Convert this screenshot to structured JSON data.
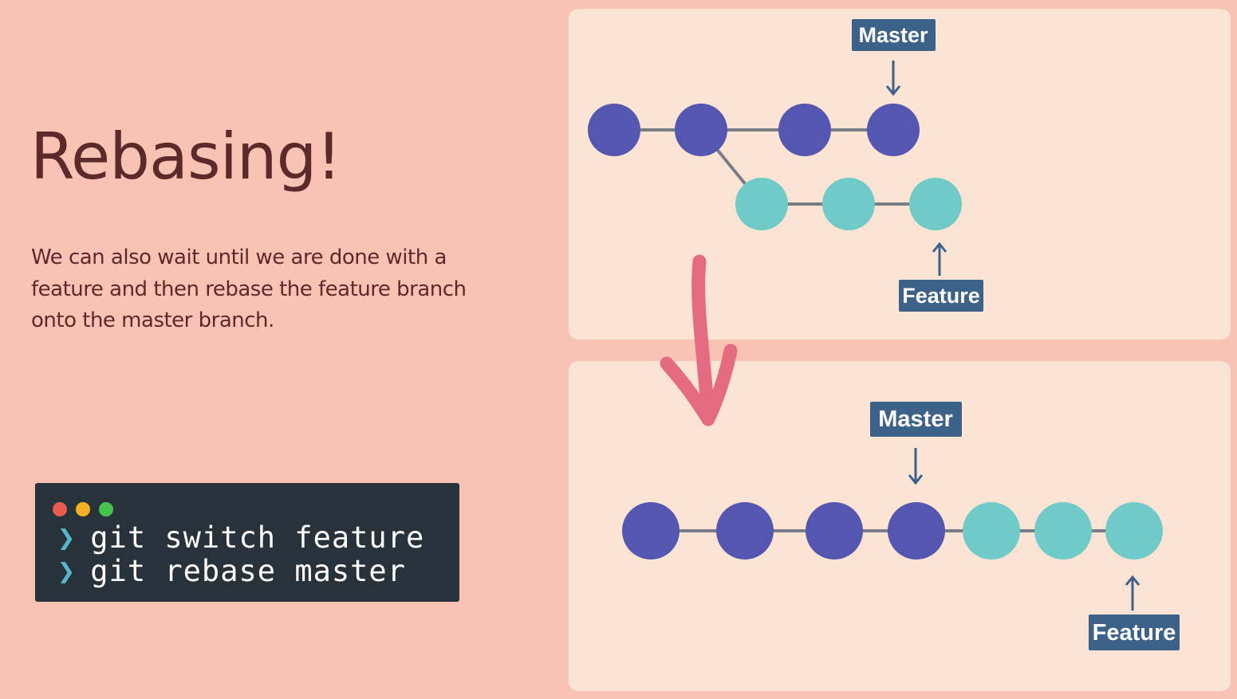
{
  "title": "Rebasing!",
  "description": "We can also wait until we are done with a feature and then rebase the feature branch onto the master branch.",
  "terminal": {
    "prompt": "❯",
    "commands": [
      "git switch feature",
      "git rebase master"
    ],
    "window_dots": [
      "#e85b4f",
      "#f2b223",
      "#46c34a"
    ]
  },
  "diagram_before": {
    "master_label": "Master",
    "feature_label": "Feature",
    "master_commits": 4,
    "feature_commits": 3,
    "feature_branches_from_commit": 2
  },
  "diagram_after": {
    "master_label": "Master",
    "feature_label": "Feature",
    "master_commits": 4,
    "feature_commits": 3
  },
  "colors": {
    "background": "#f9c3b4",
    "panel": "#fce4d5",
    "title": "#5c2a2a",
    "master_commit": "#5456b0",
    "feature_commit": "#70cac8",
    "label_box": "#3d6289",
    "connector": "#7b7d86",
    "big_arrow": "#e56b80",
    "terminal_bg": "#27323a"
  }
}
